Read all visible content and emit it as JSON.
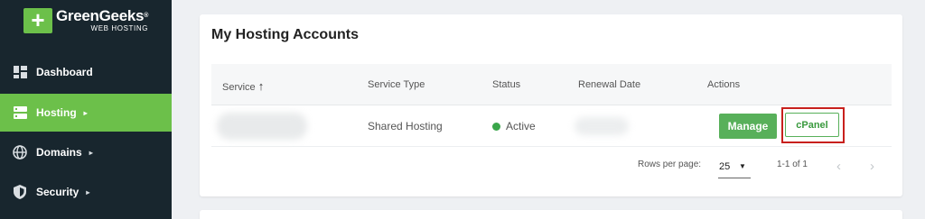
{
  "brand": {
    "name": "GreenGeeks",
    "registered_mark": "®",
    "tagline": "WEB HOSTING",
    "accent": "#6cc04a"
  },
  "sidebar": {
    "items": [
      {
        "label": "Dashboard",
        "icon": "dashboard-grid-icon",
        "active": false,
        "has_caret": false
      },
      {
        "label": "Hosting",
        "icon": "server-icon",
        "active": true,
        "has_caret": true
      },
      {
        "label": "Domains",
        "icon": "globe-icon",
        "active": false,
        "has_caret": true
      },
      {
        "label": "Security",
        "icon": "shield-icon",
        "active": false,
        "has_caret": true
      }
    ],
    "caret": "▸"
  },
  "main": {
    "title": "My Hosting Accounts",
    "columns": [
      "Service",
      "Service Type",
      "Status",
      "Renewal Date",
      "Actions"
    ],
    "sort_arrow": "↑",
    "rows": [
      {
        "service": "",
        "service_type": "Shared Hosting",
        "status": "Active",
        "status_color": "#3aa64a",
        "renewal_date": "",
        "actions": [
          "Manage",
          "cPanel"
        ]
      }
    ],
    "pagination": {
      "rows_per_page_label": "Rows per page:",
      "rows_per_page_value": "25",
      "range": "1-1 of 1",
      "prev": "‹",
      "next": "›"
    }
  },
  "colors": {
    "sidebar_bg": "#18262e",
    "manage_button": "#58b05a",
    "highlight_box": "#c8201d"
  }
}
